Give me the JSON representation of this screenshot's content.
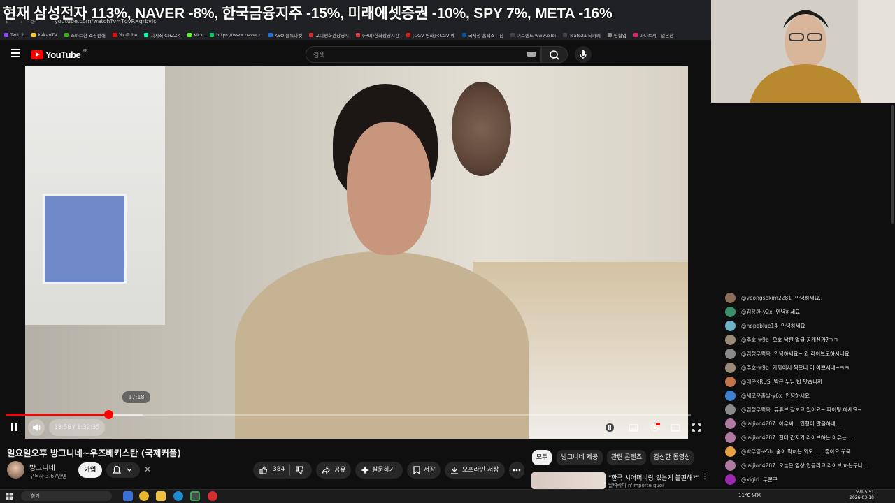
{
  "overlay": {
    "headline": "현재 삼성전자 113%, NAVER -8%, 한국금융지주 -15%, 미래에셋증권 -10%, SPY 7%, META -16%"
  },
  "browser": {
    "url": "youtube.com/watch?v=TgvRXqrbvlc",
    "bookmarks": [
      "Twitch",
      "kakaoTV",
      "스마트한 쇼핑원해",
      "YouTube",
      "치지직 CHZZK",
      "Kick",
      "https://www.naver.c",
      "KSO 블록마켓",
      "포이쟁화관상영시",
      "(구미)한화상영시간",
      "[CGV 영화]<CGV 예",
      "국세청 홈택스 - 신",
      "이트렌드 www.eToi",
      "Tcafe2a 티카페",
      "팀합업",
      "마나토끼 - 일본한"
    ]
  },
  "header": {
    "brand": "YouTube",
    "region": "KR",
    "search_placeholder": "검색"
  },
  "player": {
    "hover_time": "17:18",
    "time_display": "13:58 / 1:32:35",
    "progress_fraction": 0.151,
    "buffered_fraction": 0.2
  },
  "video_info": {
    "title": "일요일오후 방그니네~우즈베키스탄 (국제커플)",
    "channel_name": "방그니네",
    "subscribers": "구독자 3.67만명",
    "join_label": "가입",
    "like_count": "384",
    "share_label": "공유",
    "ask_label": "질문하기",
    "save_label": "저장",
    "offline_label": "오프라인 저장"
  },
  "side": {
    "chips": [
      "모두",
      "방그니네 제공",
      "관련 콘텐츠",
      "감상한 동영상"
    ],
    "rec_title": "\"한국 시어머니랑 있는게 불편해?\"",
    "rec_sub": "날벼락파 n'importe quoi"
  },
  "chat": {
    "messages": [
      {
        "author": "@yeongsokim2281",
        "text": "안녕하세요..",
        "color": "#8b6d5c"
      },
      {
        "author": "@김용환-y2x",
        "text": "안녕하세요",
        "color": "#3a8f6a"
      },
      {
        "author": "@hopeblue14",
        "text": "안녕하세요",
        "color": "#6fb3c9"
      },
      {
        "author": "@주호-w9b",
        "text": "오호 남편 얼굴 공개신가?ㅋㅋ",
        "color": "#9a8a7a"
      },
      {
        "author": "@검정우럭욱",
        "text": "안녕하세요~ 와 라이브도하시네요",
        "color": "#8a8a8a"
      },
      {
        "author": "@주호-w9b",
        "text": "가까이서 찍으니 더 이쁘시네~ㅋㅋ",
        "color": "#9a8a7a"
      },
      {
        "author": "@레온KRUS",
        "text": "방근 누님 밥 맛습니까",
        "color": "#c0764a"
      },
      {
        "author": "@새로운출발-y6x",
        "text": "안녕하세요",
        "color": "#3f7fd0"
      },
      {
        "author": "@검정우럭욱",
        "text": "유튜브 잘보고 있어요~ 파이팅 하세요~",
        "color": "#8a8a8a"
      },
      {
        "author": "@laijion4207",
        "text": "아우씨... 인형이 말을하네...",
        "color": "#b07aa0"
      },
      {
        "author": "@laijion4207",
        "text": "헌데 갑자기 라이브하는 이유는...",
        "color": "#b07aa0"
      },
      {
        "author": "@박우영-e5h",
        "text": "숨이 막히는 외모...... 좋아요 꾸욱",
        "color": "#e8a040"
      },
      {
        "author": "@laijion4207",
        "text": "오늘은 영상 안올리고 라이브 하는구나...",
        "color": "#b07aa0"
      },
      {
        "author": "@xigiri",
        "text": "두콘쿠",
        "color": "#9c27b0"
      }
    ]
  },
  "taskbar": {
    "search_label": "찾기",
    "weather": "11°C 맑음",
    "time": "오후 5:51",
    "date": "2026-03-10"
  },
  "colors": {
    "accent": "#ff0000",
    "background": "#0f0f0f"
  }
}
